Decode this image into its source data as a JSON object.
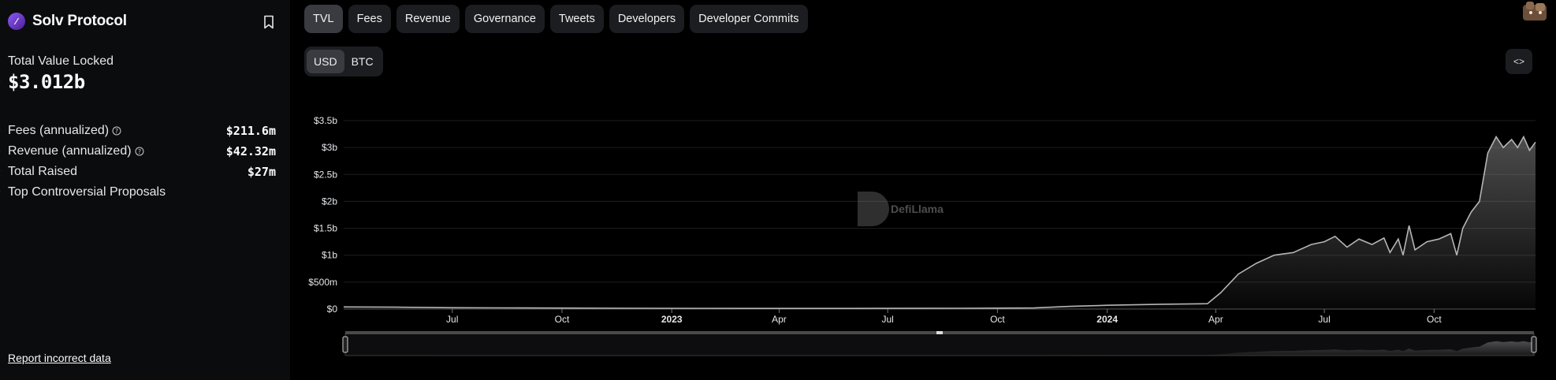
{
  "protocol": {
    "name": "Solv Protocol",
    "logo_glyph": "∕",
    "logo_color": "#7c3aed",
    "bookmark_icon": "bookmark-icon"
  },
  "tvl": {
    "label": "Total Value Locked",
    "value": "$3.012b"
  },
  "metrics": [
    {
      "label": "Fees (annualized)",
      "value": "$211.6m",
      "help": true
    },
    {
      "label": "Revenue (annualized)",
      "value": "$42.32m",
      "help": true
    },
    {
      "label": "Total Raised",
      "value": "$27m",
      "help": false
    },
    {
      "label": "Top Controversial Proposals",
      "value": "",
      "help": false
    }
  ],
  "report_link": "Report incorrect data",
  "tabs": [
    {
      "label": "TVL",
      "active": true
    },
    {
      "label": "Fees",
      "active": false
    },
    {
      "label": "Revenue",
      "active": false
    },
    {
      "label": "Governance",
      "active": false
    },
    {
      "label": "Tweets",
      "active": false
    },
    {
      "label": "Developers",
      "active": false
    },
    {
      "label": "Developer Commits",
      "active": false
    }
  ],
  "currency": {
    "options": [
      "USD",
      "BTC"
    ],
    "selected": "USD"
  },
  "embed_button": "<>",
  "watermark": "DefiLlama",
  "colors": {
    "background": "#000000",
    "sidebar": "#0b0c0e",
    "line": "#b5b5b5",
    "button": "#1c1d21",
    "button_active": "#3a3b40"
  },
  "chart_data": {
    "type": "area",
    "title": "",
    "xlabel": "",
    "ylabel": "",
    "ylim": [
      0,
      3500000000
    ],
    "y_ticks": [
      "$0",
      "$500m",
      "$1b",
      "$1.5b",
      "$2b",
      "$2.5b",
      "$3b",
      "$3.5b"
    ],
    "x_ticks": [
      {
        "label": "Jul",
        "date": "2022-07-01",
        "bold": false
      },
      {
        "label": "Oct",
        "date": "2022-10-01",
        "bold": false
      },
      {
        "label": "2023",
        "date": "2023-01-01",
        "bold": true
      },
      {
        "label": "Apr",
        "date": "2023-04-01",
        "bold": false
      },
      {
        "label": "Jul",
        "date": "2023-07-01",
        "bold": false
      },
      {
        "label": "Oct",
        "date": "2023-10-01",
        "bold": false
      },
      {
        "label": "2024",
        "date": "2024-01-01",
        "bold": true
      },
      {
        "label": "Apr",
        "date": "2024-04-01",
        "bold": false
      },
      {
        "label": "Jul",
        "date": "2024-07-01",
        "bold": false
      },
      {
        "label": "Oct",
        "date": "2024-10-01",
        "bold": false
      }
    ],
    "x_range": [
      "2022-04-01",
      "2024-12-25"
    ],
    "grid": "horizontal",
    "series": [
      {
        "points": [
          [
            "2022-04-01",
            40000000
          ],
          [
            "2022-05-15",
            35000000
          ],
          [
            "2022-07-01",
            25000000
          ],
          [
            "2022-09-01",
            20000000
          ],
          [
            "2022-12-01",
            15000000
          ],
          [
            "2023-03-01",
            12000000
          ],
          [
            "2023-06-01",
            12000000
          ],
          [
            "2023-09-01",
            15000000
          ],
          [
            "2023-11-01",
            20000000
          ],
          [
            "2023-12-01",
            50000000
          ],
          [
            "2024-01-01",
            70000000
          ],
          [
            "2024-02-15",
            90000000
          ],
          [
            "2024-03-25",
            100000000
          ],
          [
            "2024-04-05",
            300000000
          ],
          [
            "2024-04-20",
            650000000
          ],
          [
            "2024-05-05",
            850000000
          ],
          [
            "2024-05-20",
            1000000000
          ],
          [
            "2024-06-05",
            1050000000
          ],
          [
            "2024-06-20",
            1200000000
          ],
          [
            "2024-07-01",
            1250000000
          ],
          [
            "2024-07-10",
            1350000000
          ],
          [
            "2024-07-20",
            1150000000
          ],
          [
            "2024-07-30",
            1300000000
          ],
          [
            "2024-08-10",
            1200000000
          ],
          [
            "2024-08-20",
            1320000000
          ],
          [
            "2024-08-25",
            1050000000
          ],
          [
            "2024-09-01",
            1300000000
          ],
          [
            "2024-09-05",
            1000000000
          ],
          [
            "2024-09-10",
            1550000000
          ],
          [
            "2024-09-15",
            1100000000
          ],
          [
            "2024-09-25",
            1250000000
          ],
          [
            "2024-10-05",
            1300000000
          ],
          [
            "2024-10-15",
            1400000000
          ],
          [
            "2024-10-20",
            1000000000
          ],
          [
            "2024-10-25",
            1500000000
          ],
          [
            "2024-11-01",
            1800000000
          ],
          [
            "2024-11-08",
            2000000000
          ],
          [
            "2024-11-15",
            2900000000
          ],
          [
            "2024-11-22",
            3200000000
          ],
          [
            "2024-11-28",
            3000000000
          ],
          [
            "2024-12-05",
            3150000000
          ],
          [
            "2024-12-10",
            3000000000
          ],
          [
            "2024-12-15",
            3200000000
          ],
          [
            "2024-12-20",
            2950000000
          ],
          [
            "2024-12-25",
            3100000000
          ]
        ]
      }
    ]
  }
}
